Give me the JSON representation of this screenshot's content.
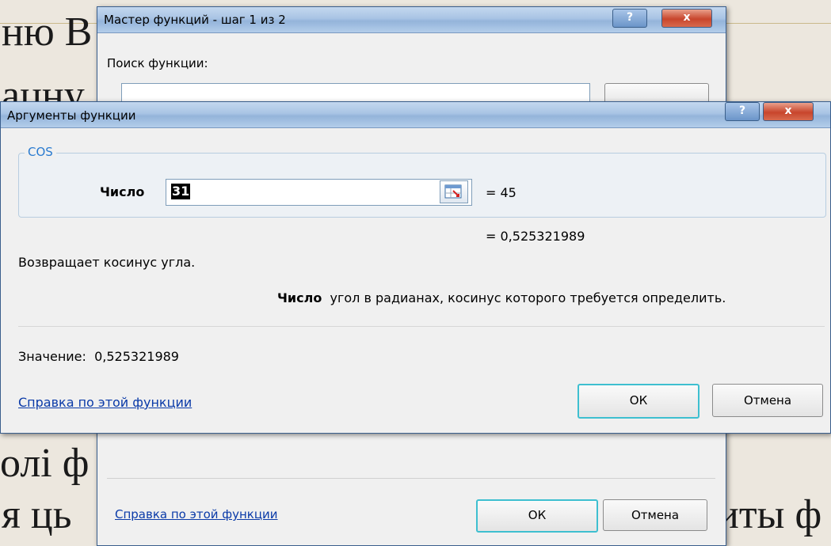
{
  "background_slide": {
    "fragments": [
      "ню В",
      "ацну",
      "у",
      "олі ф",
      "я ць",
      "иты ф"
    ]
  },
  "wizard": {
    "title": "Мастер функций - шаг 1 из 2",
    "help_btn": "?",
    "close_btn": "x",
    "search_label": "Поиск функции:",
    "help_link": "Справка по этой функции",
    "ok_label": "ОК",
    "cancel_label": "Отмена"
  },
  "args": {
    "title": "Аргументы функции",
    "help_btn": "?",
    "close_btn": "x",
    "function_name": "COS",
    "arg_label": "Число",
    "arg_value": "31",
    "arg_eval": "= 45",
    "result_eval": "= 0,525321989",
    "description": "Возвращает косинус угла.",
    "arg_name_bold": "Число",
    "arg_description": "угол в радианах, косинус которого требуется определить.",
    "value_label": "Значение:",
    "value": "0,525321989",
    "help_link": "Справка по этой функции",
    "ok_label": "ОК",
    "cancel_label": "Отмена"
  }
}
